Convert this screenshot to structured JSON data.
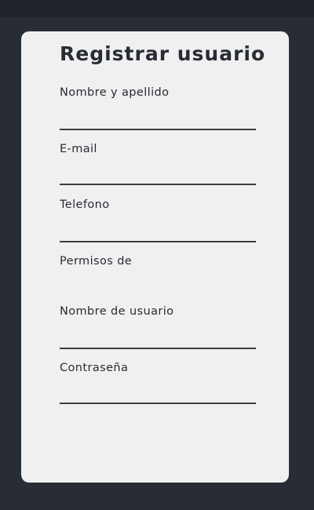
{
  "form": {
    "title": "Registrar usuario",
    "fields": [
      {
        "label": "Nombre y apellido",
        "value": ""
      },
      {
        "label": "E-mail",
        "value": ""
      },
      {
        "label": "Telefono",
        "value": ""
      },
      {
        "label": "Permisos de",
        "value": ""
      },
      {
        "label": "Nombre de usuario",
        "value": ""
      },
      {
        "label": "Contraseña",
        "value": ""
      }
    ]
  }
}
